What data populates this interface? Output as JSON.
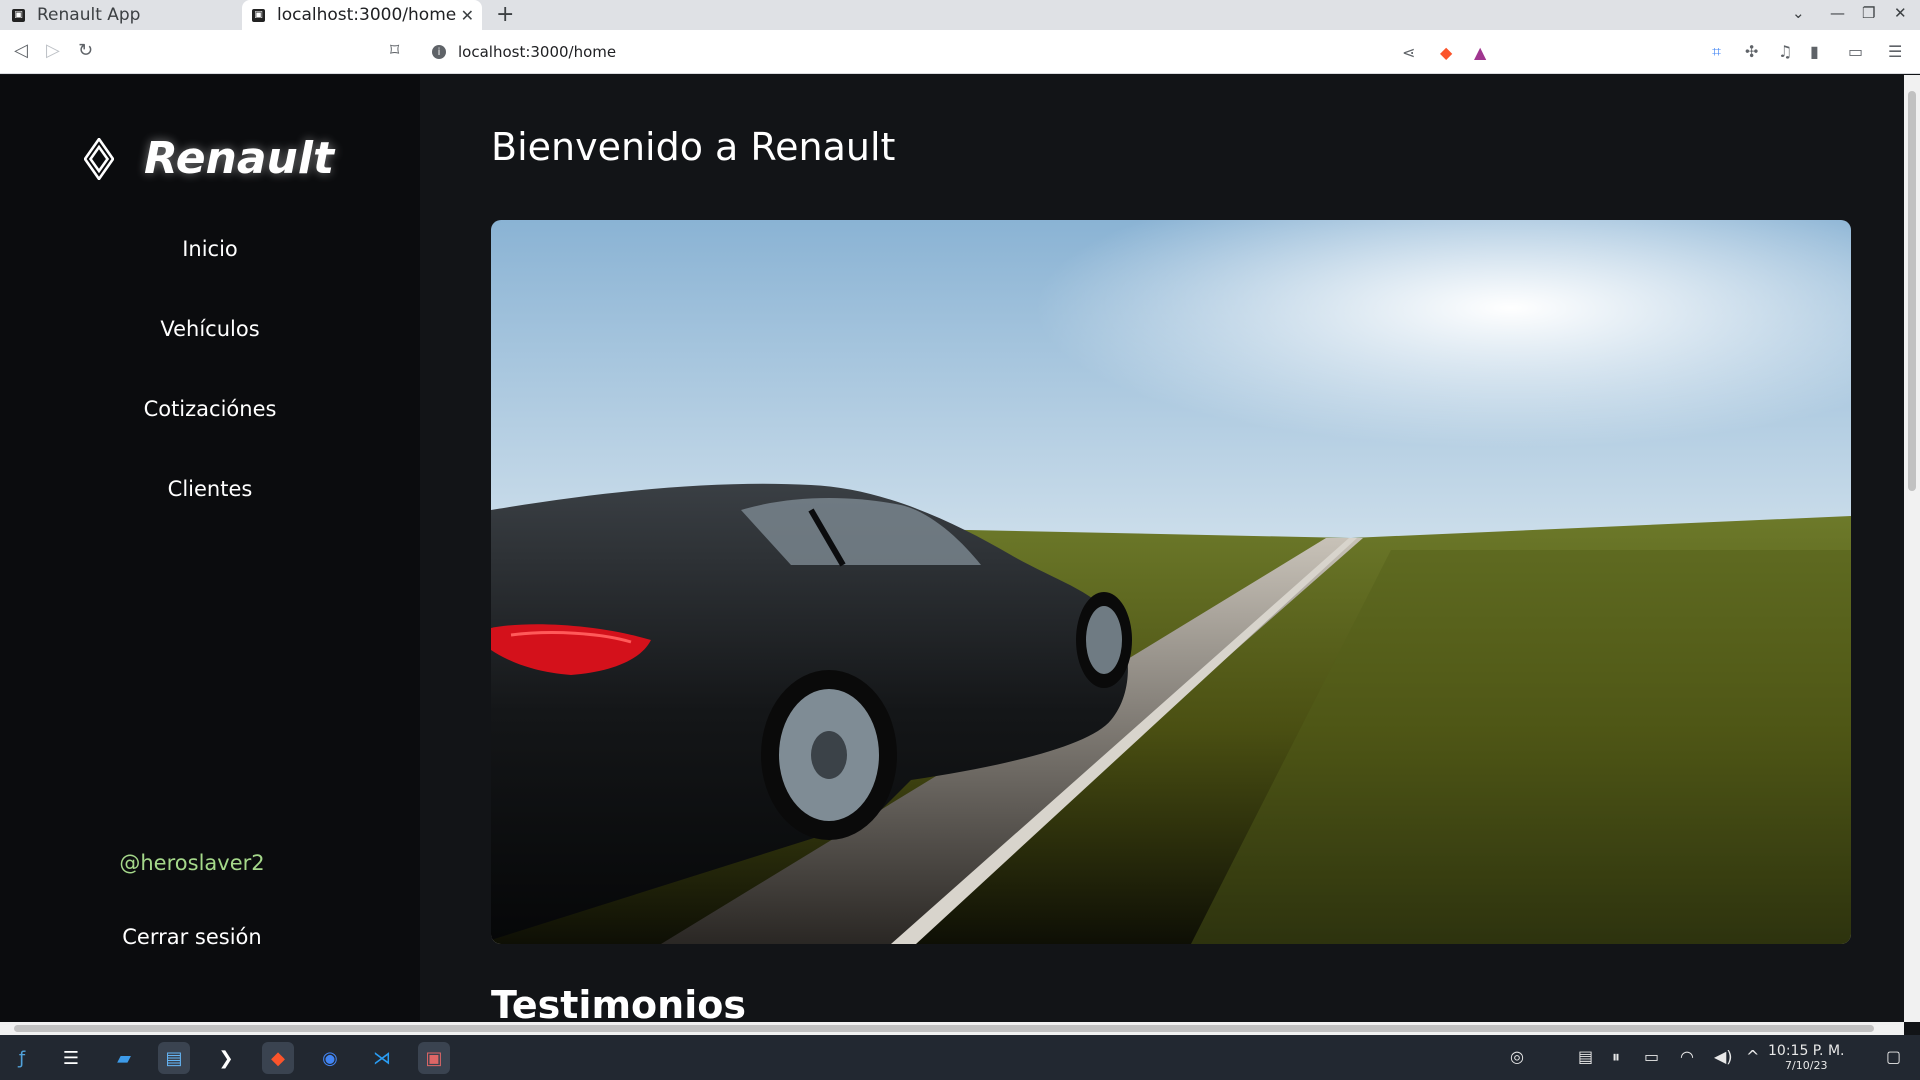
{
  "browser": {
    "tabs": [
      {
        "title": "Renault App",
        "active": false
      },
      {
        "title": "localhost:3000/home",
        "active": true
      }
    ],
    "url": "localhost:3000/home"
  },
  "app": {
    "brand": "Renault",
    "nav": [
      {
        "label": "Inicio"
      },
      {
        "label": "Vehículos"
      },
      {
        "label": "Cotizaciónes"
      },
      {
        "label": "Clientes"
      }
    ],
    "user_handle": "@heroslaver2",
    "logout_label": "Cerrar sesión",
    "main_title": "Bienvenido a Renault",
    "section_title": "Testimonios"
  },
  "taskbar": {
    "time": "10:15 P. M.",
    "date": "7/10/23"
  },
  "colors": {
    "sidebar_bg": "#0b0c0e",
    "main_bg": "#121417",
    "handle_green": "#a5d88a"
  }
}
